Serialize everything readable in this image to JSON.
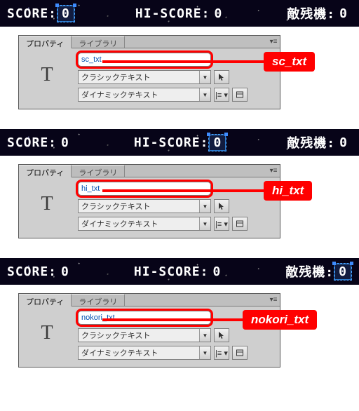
{
  "hud": {
    "score_label": "SCORE:",
    "score_value": "0",
    "hi_label": "HI-SCORE:",
    "hi_value": "0",
    "nokori_label": "敵残機:",
    "nokori_value": "0"
  },
  "panel": {
    "tabs": {
      "properties": "プロパティ",
      "library": "ライブラリ"
    },
    "type_glyph": "T",
    "type_combo": "クラシックテキスト",
    "kind_combo": "ダイナミックテキスト"
  },
  "instances": {
    "sc": {
      "name": "sc_txt",
      "callout": "sc_txt"
    },
    "hi": {
      "name": "hi_txt",
      "callout": "hi_txt"
    },
    "nokori": {
      "name": "nokori_txt",
      "callout": "nokori_txt"
    }
  }
}
